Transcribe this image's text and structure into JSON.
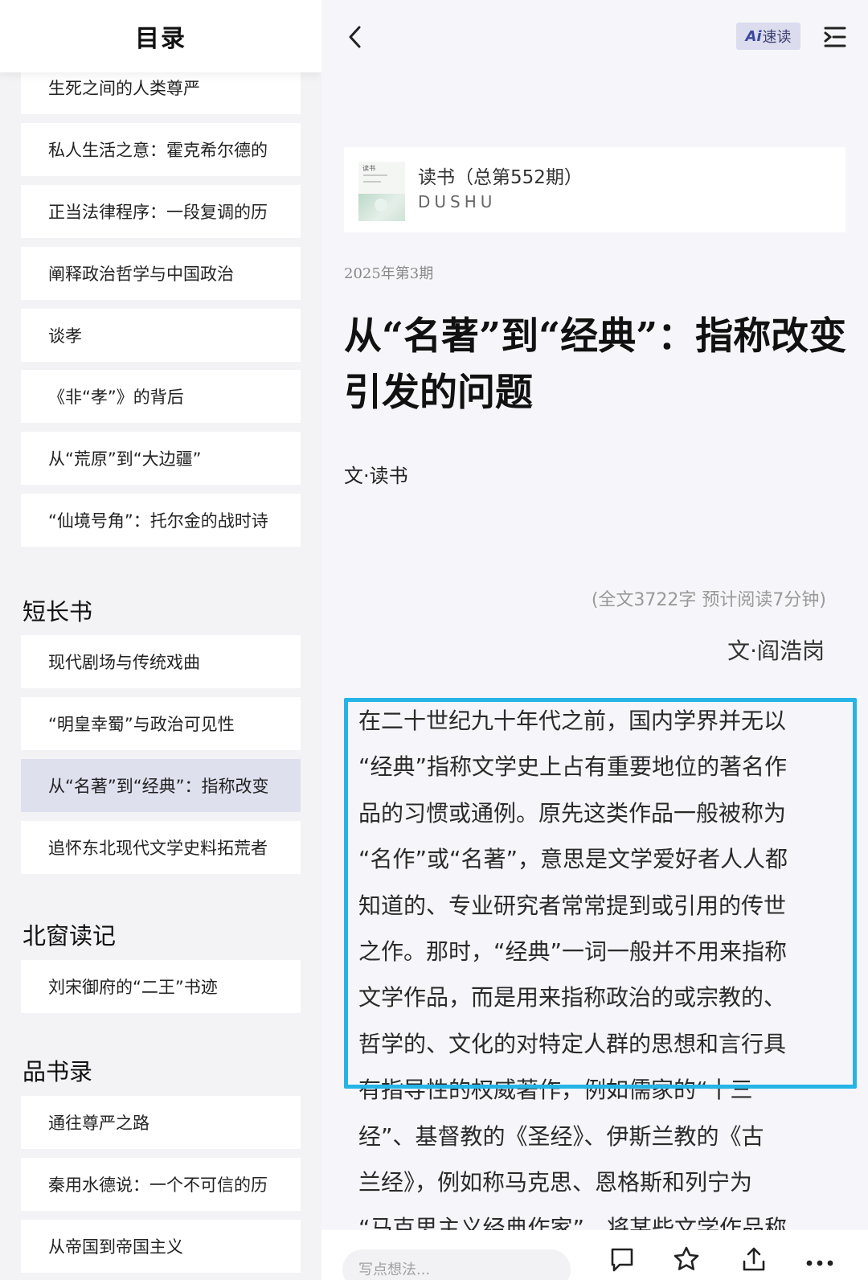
{
  "sidebar": {
    "title": "目录",
    "items_top": [
      {
        "label": "生死之间的人类尊严"
      },
      {
        "label": "私人生活之意：霍克希尔德的"
      },
      {
        "label": "正当法律程序：一段复调的历"
      },
      {
        "label": "阐释政治哲学与中国政治"
      },
      {
        "label": "谈孝"
      },
      {
        "label": "《非“孝”》的背后"
      },
      {
        "label": "从“荒原”到“大边疆”"
      },
      {
        "label": "“仙境号角”：托尔金的战时诗"
      }
    ],
    "section_1": {
      "title": "短长书",
      "items": [
        {
          "label": "现代剧场与传统戏曲"
        },
        {
          "label": "“明皇幸蜀”与政治可见性"
        },
        {
          "label": "从“名著”到“经典”：指称改变"
        },
        {
          "label": "追怀东北现代文学史料拓荒者"
        }
      ]
    },
    "section_2": {
      "title": "北窗读记",
      "items": [
        {
          "label": "刘宋御府的“二王”书迹"
        }
      ]
    },
    "section_3": {
      "title": "品书录",
      "items": [
        {
          "label": "通往尊严之路"
        },
        {
          "label": "秦用水德说：一个不可信的历"
        },
        {
          "label": "从帝国到帝国主义"
        }
      ]
    },
    "active_item": "从“名著”到“经典”：指称改变"
  },
  "header": {
    "ai_prefix": "Ai",
    "ai_label": "速读"
  },
  "magazine": {
    "cover_label": "读书",
    "name": "读书（总第552期）",
    "subtitle": "DUSHU"
  },
  "article": {
    "issue": "2025年第3期",
    "title": "从“名著”到“经典”：指称改变引发的问题",
    "byline": "文·读书",
    "meta": "(全文3722字 预计阅读7分钟)",
    "author": "文·阎浩岗",
    "lines": [
      "在二十世纪九十年代之前，国内学界并无以",
      "“经典”指称文学史上占有重要地位的著名作",
      "品的习惯或通例。原先这类作品一般被称为",
      "“名作”或“名著”，意思是文学爱好者人人都",
      "知道的、专业研究者常常提到或引用的传世",
      "之作。那时，“经典”一词一般并不用来指称",
      "文学作品，而是用来指称政治的或宗教的、",
      "哲学的、文化的对特定人群的思想和言行具",
      "有指导性的权威著作，例如儒家的“十三",
      "经”、基督教的《圣经》、伊斯兰教的《古",
      "兰经》，例如称马克思、恩格斯和列宁为",
      "“马克思主义经典作家”，将某些文学作品称"
    ]
  },
  "bottom_bar": {
    "comment_placeholder": "写点想法..."
  },
  "colors": {
    "accent_highlight": "#26b4e6",
    "active_item_bg": "#dfe0ee",
    "ai_button_bg": "#dcdcef"
  },
  "icons": [
    "chevron-left-icon",
    "toc-menu-icon",
    "comment-icon",
    "star-icon",
    "share-icon",
    "more-icon"
  ]
}
